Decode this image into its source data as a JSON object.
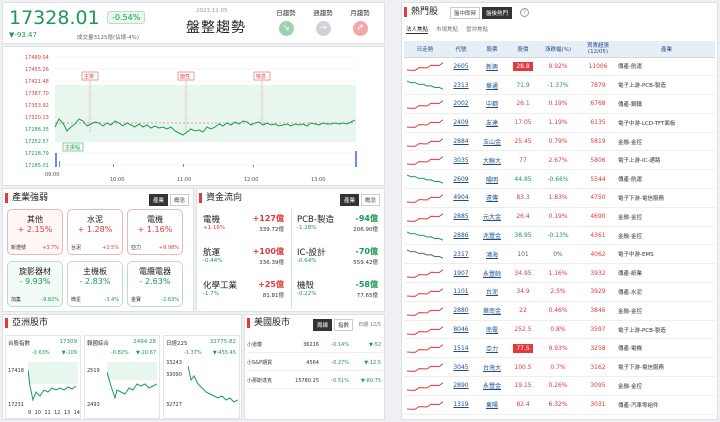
{
  "header": {
    "index_value": "17328.01",
    "change_pct": "-0.54%",
    "change_pts": "▼-93.47",
    "volume": "成交量3125億(佔總-4%)",
    "date": "2023.12.05",
    "title": "盤整趨勢",
    "trend_buttons": [
      {
        "label": "日趨勢"
      },
      {
        "label": "週趨勢"
      },
      {
        "label": "月趨勢"
      }
    ]
  },
  "intraday": {
    "y_ticks": [
      "17489.04",
      "17455.26",
      "17421.48",
      "17387.70",
      "17353.92",
      "17320.13",
      "17286.35",
      "17252.57",
      "17218.79",
      "17185.01"
    ],
    "x_ticks": [
      "10:00",
      "11:00",
      "12:00",
      "13:00"
    ],
    "open_label": "09:00",
    "markers": [
      "主宰",
      "面性",
      "喘息"
    ],
    "badge": "主振幅"
  },
  "industry": {
    "title": "產業強弱",
    "tabs": [
      "產業",
      "概念"
    ],
    "cards": [
      {
        "name": "其他",
        "pct": "+ 2.15%",
        "stock": "新燈號",
        "spct": "+3.7%",
        "color": "red"
      },
      {
        "name": "水泥",
        "pct": "+ 1.28%",
        "stock": "台泥",
        "spct": "+2.5%",
        "color": "red"
      },
      {
        "name": "電機",
        "pct": "+ 1.16%",
        "stock": "亞力",
        "spct": "+9.98%",
        "color": "red"
      },
      {
        "name": "旋影器材",
        "pct": "- 9.93%",
        "stock": "加集",
        "spct": "-9.82%",
        "color": "green"
      },
      {
        "name": "主機板",
        "pct": "- 2.83%",
        "stock": "微星",
        "spct": "-3.4%",
        "color": "green"
      },
      {
        "name": "電纜電器",
        "pct": "- 2.63%",
        "stock": "金寶",
        "spct": "-2.63%",
        "color": "green"
      }
    ]
  },
  "capital": {
    "title": "資金流向",
    "tabs": [
      "產業",
      "概念"
    ],
    "flows": [
      {
        "name": "電機",
        "amt": "+127億",
        "pct": "+1.16%",
        "val": "339.72億",
        "dir": "red"
      },
      {
        "name": "PCB-製造",
        "amt": "-94億",
        "pct": "-1.28%",
        "val": "206.90億",
        "dir": "green"
      },
      {
        "name": "航運",
        "amt": "+100億",
        "pct": "-0.44%",
        "val": "336.39億",
        "dir": "red"
      },
      {
        "name": "IC-設計",
        "amt": "-70億",
        "pct": "-0.64%",
        "val": "559.42億",
        "dir": "green"
      },
      {
        "name": "化學工業",
        "amt": "+25億",
        "pct": "-1.7%",
        "val": "81.81億",
        "dir": "red"
      },
      {
        "name": "機殼",
        "amt": "-58億",
        "pct": "-0.22%",
        "val": "77.65億",
        "dir": "green"
      }
    ]
  },
  "asia": {
    "title": "亞洲股市",
    "markets": [
      {
        "name": "台股指數",
        "value": "17309",
        "pct": "-0.63%",
        "chg": "▼-109",
        "yt": [
          "17418",
          "17231"
        ]
      },
      {
        "name": "韓國綜合",
        "value": "2494.28",
        "pct": "-0.82%",
        "chg": "▼-20.67",
        "yt": [
          "2519",
          "2493"
        ]
      },
      {
        "name": "日經225",
        "value": "32775.82",
        "pct": "-1.37%",
        "chg": "▼-455.45",
        "yt": [
          "33243",
          "33090",
          "32727"
        ]
      }
    ],
    "xt": [
      "9",
      "10",
      "11",
      "12",
      "13",
      "14"
    ]
  },
  "us": {
    "title": "美國股市",
    "tabs": [
      "周線",
      "指數"
    ],
    "date": "日期 12/5",
    "rows": [
      {
        "name": "小道瓊",
        "value": "36216",
        "pct": "-0.14%",
        "chg": "▼-52"
      },
      {
        "name": "小S&P期貨",
        "value": "4564",
        "pct": "-0.27%",
        "chg": "▼-12.5"
      },
      {
        "name": "小那斯達克",
        "value": "15780.25",
        "pct": "-0.51%",
        "chg": "▼-80.75"
      }
    ]
  },
  "hot": {
    "title": "熱門股",
    "top_tabs": [
      "盤中即時",
      "盤後熱門"
    ],
    "sub_tabs": [
      "法人焦點",
      "市場焦點",
      "當沖焦點"
    ],
    "columns": [
      "日走勢",
      "代號",
      "股票",
      "股價",
      "漲跌幅(%)",
      "買賣超張\n(12/05)",
      "產業"
    ],
    "rows": [
      {
        "code": "2605",
        "name": "新興",
        "price": "28.8",
        "chg": "9.92%",
        "vol": "11006",
        "ind": "傳產-航運",
        "dir": "red",
        "box": true
      },
      {
        "code": "2313",
        "name": "華通",
        "price": "71.9",
        "chg": "-1.37%",
        "vol": "7879",
        "ind": "電子上游-PCB-製造",
        "dir": "green"
      },
      {
        "code": "2002",
        "name": "中鋼",
        "price": "26.1",
        "chg": "0.19%",
        "vol": "6768",
        "ind": "傳產-鋼鐵",
        "dir": "red"
      },
      {
        "code": "2409",
        "name": "友達",
        "price": "17.05",
        "chg": "1.19%",
        "vol": "6135",
        "ind": "電子中游-LCD-TFT面板",
        "dir": "red"
      },
      {
        "code": "2884",
        "name": "玉山金",
        "price": "25.45",
        "chg": "0.79%",
        "vol": "5819",
        "ind": "金融-金控",
        "dir": "red"
      },
      {
        "code": "3035",
        "name": "大聯大",
        "price": "77",
        "chg": "2.67%",
        "vol": "5806",
        "ind": "電子上游-IC-通路",
        "dir": "red"
      },
      {
        "code": "2609",
        "name": "陽明",
        "price": "44.85",
        "chg": "-0.66%",
        "vol": "5544",
        "ind": "傳產-航運",
        "dir": "green"
      },
      {
        "code": "4904",
        "name": "遠傳",
        "price": "83.3",
        "chg": "1.83%",
        "vol": "4750",
        "ind": "電子下游-電信服務",
        "dir": "red"
      },
      {
        "code": "2885",
        "name": "元大金",
        "price": "26.4",
        "chg": "0.19%",
        "vol": "4690",
        "ind": "金融-金控",
        "dir": "red"
      },
      {
        "code": "2886",
        "name": "兆豐金",
        "price": "38.95",
        "chg": "-0.13%",
        "vol": "4361",
        "ind": "金融-金控",
        "dir": "green"
      },
      {
        "code": "2317",
        "name": "鴻海",
        "price": "101",
        "chg": "0%",
        "vol": "4062",
        "ind": "電子中游-EMS",
        "dir": "gray"
      },
      {
        "code": "1907",
        "name": "永豐餘",
        "price": "34.95",
        "chg": "1.16%",
        "vol": "3932",
        "ind": "傳產-紙業",
        "dir": "red"
      },
      {
        "code": "1101",
        "name": "台泥",
        "price": "34.9",
        "chg": "2.5%",
        "vol": "3929",
        "ind": "傳產-水泥",
        "dir": "red"
      },
      {
        "code": "2880",
        "name": "華南金",
        "price": "22",
        "chg": "0.46%",
        "vol": "3846",
        "ind": "金融-金控",
        "dir": "red"
      },
      {
        "code": "8046",
        "name": "南電",
        "price": "252.5",
        "chg": "0.8%",
        "vol": "3597",
        "ind": "電子上游-PCB-製造",
        "dir": "red"
      },
      {
        "code": "1514",
        "name": "亞力",
        "price": "77.5",
        "chg": "9.93%",
        "vol": "3258",
        "ind": "傳產-電機",
        "dir": "red",
        "box": true
      },
      {
        "code": "3045",
        "name": "台灣大",
        "price": "100.5",
        "chg": "0.7%",
        "vol": "3162",
        "ind": "電子下游-電信服務",
        "dir": "red"
      },
      {
        "code": "2890",
        "name": "永豐金",
        "price": "19.15",
        "chg": "0.26%",
        "vol": "3095",
        "ind": "金融-金控",
        "dir": "red"
      },
      {
        "code": "1319",
        "name": "東陽",
        "price": "82.4",
        "chg": "6.32%",
        "vol": "3031",
        "ind": "傳產-汽車零組件",
        "dir": "red"
      }
    ]
  }
}
